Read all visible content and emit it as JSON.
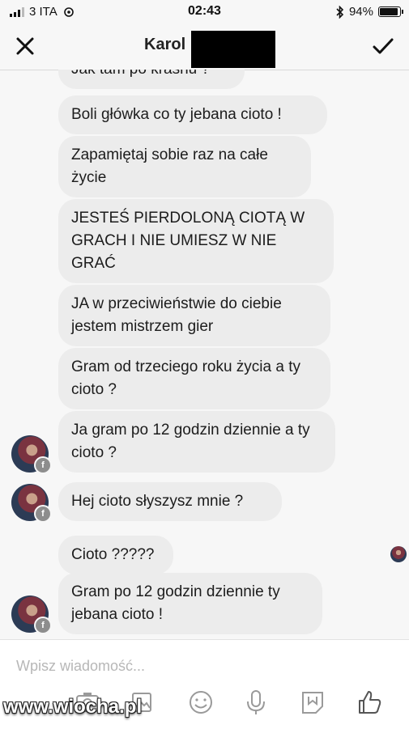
{
  "status_bar": {
    "carrier": "3 ITA",
    "time": "02:43",
    "battery": "94%"
  },
  "header": {
    "title": "Karol"
  },
  "messages": [
    {
      "text": "Jak tam po krasnu ?"
    },
    {
      "text": "Boli główka co ty jebana cioto !"
    },
    {
      "text": "Zapamiętaj sobie raz na całe życie"
    },
    {
      "text": "JESTEŚ PIERDOLONĄ CIOTĄ W GRACH I NIE UMIESZ W NIE GRAĆ"
    },
    {
      "text": "JA w przeciwieństwie do ciebie jestem mistrzem gier"
    },
    {
      "text": "Gram od trzeciego roku życia a ty cioto ?"
    },
    {
      "text": "Ja gram po 12 godzin dziennie a ty cioto ?"
    },
    {
      "text": "Hej cioto słyszysz mnie ?"
    },
    {
      "text": "Cioto ?????"
    },
    {
      "text": "Gram po 12 godzin dziennie ty jebana cioto !"
    }
  ],
  "composer": {
    "placeholder": "Wpisz wiadomość..."
  },
  "watermark": "www.wiocha.pl",
  "icons": [
    "close-icon",
    "check-icon",
    "camera-icon",
    "gallery-icon",
    "emoji-icon",
    "microphone-icon",
    "sticker-icon",
    "thumbs-up-icon"
  ]
}
